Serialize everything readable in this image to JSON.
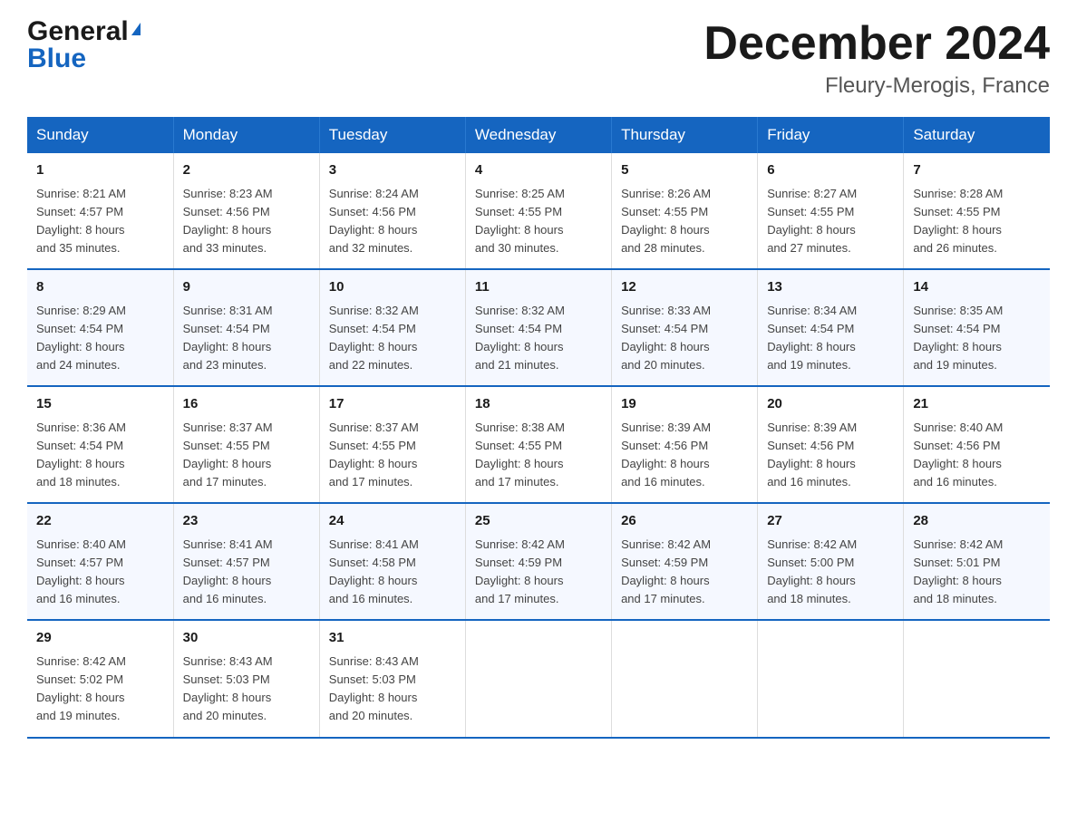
{
  "logo": {
    "general": "General",
    "blue": "Blue"
  },
  "title": {
    "month": "December 2024",
    "location": "Fleury-Merogis, France"
  },
  "weekdays": [
    "Sunday",
    "Monday",
    "Tuesday",
    "Wednesday",
    "Thursday",
    "Friday",
    "Saturday"
  ],
  "weeks": [
    [
      {
        "day": "1",
        "sunrise": "8:21 AM",
        "sunset": "4:57 PM",
        "daylight": "8 hours and 35 minutes."
      },
      {
        "day": "2",
        "sunrise": "8:23 AM",
        "sunset": "4:56 PM",
        "daylight": "8 hours and 33 minutes."
      },
      {
        "day": "3",
        "sunrise": "8:24 AM",
        "sunset": "4:56 PM",
        "daylight": "8 hours and 32 minutes."
      },
      {
        "day": "4",
        "sunrise": "8:25 AM",
        "sunset": "4:55 PM",
        "daylight": "8 hours and 30 minutes."
      },
      {
        "day": "5",
        "sunrise": "8:26 AM",
        "sunset": "4:55 PM",
        "daylight": "8 hours and 28 minutes."
      },
      {
        "day": "6",
        "sunrise": "8:27 AM",
        "sunset": "4:55 PM",
        "daylight": "8 hours and 27 minutes."
      },
      {
        "day": "7",
        "sunrise": "8:28 AM",
        "sunset": "4:55 PM",
        "daylight": "8 hours and 26 minutes."
      }
    ],
    [
      {
        "day": "8",
        "sunrise": "8:29 AM",
        "sunset": "4:54 PM",
        "daylight": "8 hours and 24 minutes."
      },
      {
        "day": "9",
        "sunrise": "8:31 AM",
        "sunset": "4:54 PM",
        "daylight": "8 hours and 23 minutes."
      },
      {
        "day": "10",
        "sunrise": "8:32 AM",
        "sunset": "4:54 PM",
        "daylight": "8 hours and 22 minutes."
      },
      {
        "day": "11",
        "sunrise": "8:32 AM",
        "sunset": "4:54 PM",
        "daylight": "8 hours and 21 minutes."
      },
      {
        "day": "12",
        "sunrise": "8:33 AM",
        "sunset": "4:54 PM",
        "daylight": "8 hours and 20 minutes."
      },
      {
        "day": "13",
        "sunrise": "8:34 AM",
        "sunset": "4:54 PM",
        "daylight": "8 hours and 19 minutes."
      },
      {
        "day": "14",
        "sunrise": "8:35 AM",
        "sunset": "4:54 PM",
        "daylight": "8 hours and 19 minutes."
      }
    ],
    [
      {
        "day": "15",
        "sunrise": "8:36 AM",
        "sunset": "4:54 PM",
        "daylight": "8 hours and 18 minutes."
      },
      {
        "day": "16",
        "sunrise": "8:37 AM",
        "sunset": "4:55 PM",
        "daylight": "8 hours and 17 minutes."
      },
      {
        "day": "17",
        "sunrise": "8:37 AM",
        "sunset": "4:55 PM",
        "daylight": "8 hours and 17 minutes."
      },
      {
        "day": "18",
        "sunrise": "8:38 AM",
        "sunset": "4:55 PM",
        "daylight": "8 hours and 17 minutes."
      },
      {
        "day": "19",
        "sunrise": "8:39 AM",
        "sunset": "4:56 PM",
        "daylight": "8 hours and 16 minutes."
      },
      {
        "day": "20",
        "sunrise": "8:39 AM",
        "sunset": "4:56 PM",
        "daylight": "8 hours and 16 minutes."
      },
      {
        "day": "21",
        "sunrise": "8:40 AM",
        "sunset": "4:56 PM",
        "daylight": "8 hours and 16 minutes."
      }
    ],
    [
      {
        "day": "22",
        "sunrise": "8:40 AM",
        "sunset": "4:57 PM",
        "daylight": "8 hours and 16 minutes."
      },
      {
        "day": "23",
        "sunrise": "8:41 AM",
        "sunset": "4:57 PM",
        "daylight": "8 hours and 16 minutes."
      },
      {
        "day": "24",
        "sunrise": "8:41 AM",
        "sunset": "4:58 PM",
        "daylight": "8 hours and 16 minutes."
      },
      {
        "day": "25",
        "sunrise": "8:42 AM",
        "sunset": "4:59 PM",
        "daylight": "8 hours and 17 minutes."
      },
      {
        "day": "26",
        "sunrise": "8:42 AM",
        "sunset": "4:59 PM",
        "daylight": "8 hours and 17 minutes."
      },
      {
        "day": "27",
        "sunrise": "8:42 AM",
        "sunset": "5:00 PM",
        "daylight": "8 hours and 18 minutes."
      },
      {
        "day": "28",
        "sunrise": "8:42 AM",
        "sunset": "5:01 PM",
        "daylight": "8 hours and 18 minutes."
      }
    ],
    [
      {
        "day": "29",
        "sunrise": "8:42 AM",
        "sunset": "5:02 PM",
        "daylight": "8 hours and 19 minutes."
      },
      {
        "day": "30",
        "sunrise": "8:43 AM",
        "sunset": "5:03 PM",
        "daylight": "8 hours and 20 minutes."
      },
      {
        "day": "31",
        "sunrise": "8:43 AM",
        "sunset": "5:03 PM",
        "daylight": "8 hours and 20 minutes."
      },
      null,
      null,
      null,
      null
    ]
  ],
  "labels": {
    "sunrise": "Sunrise:",
    "sunset": "Sunset:",
    "daylight": "Daylight:"
  }
}
